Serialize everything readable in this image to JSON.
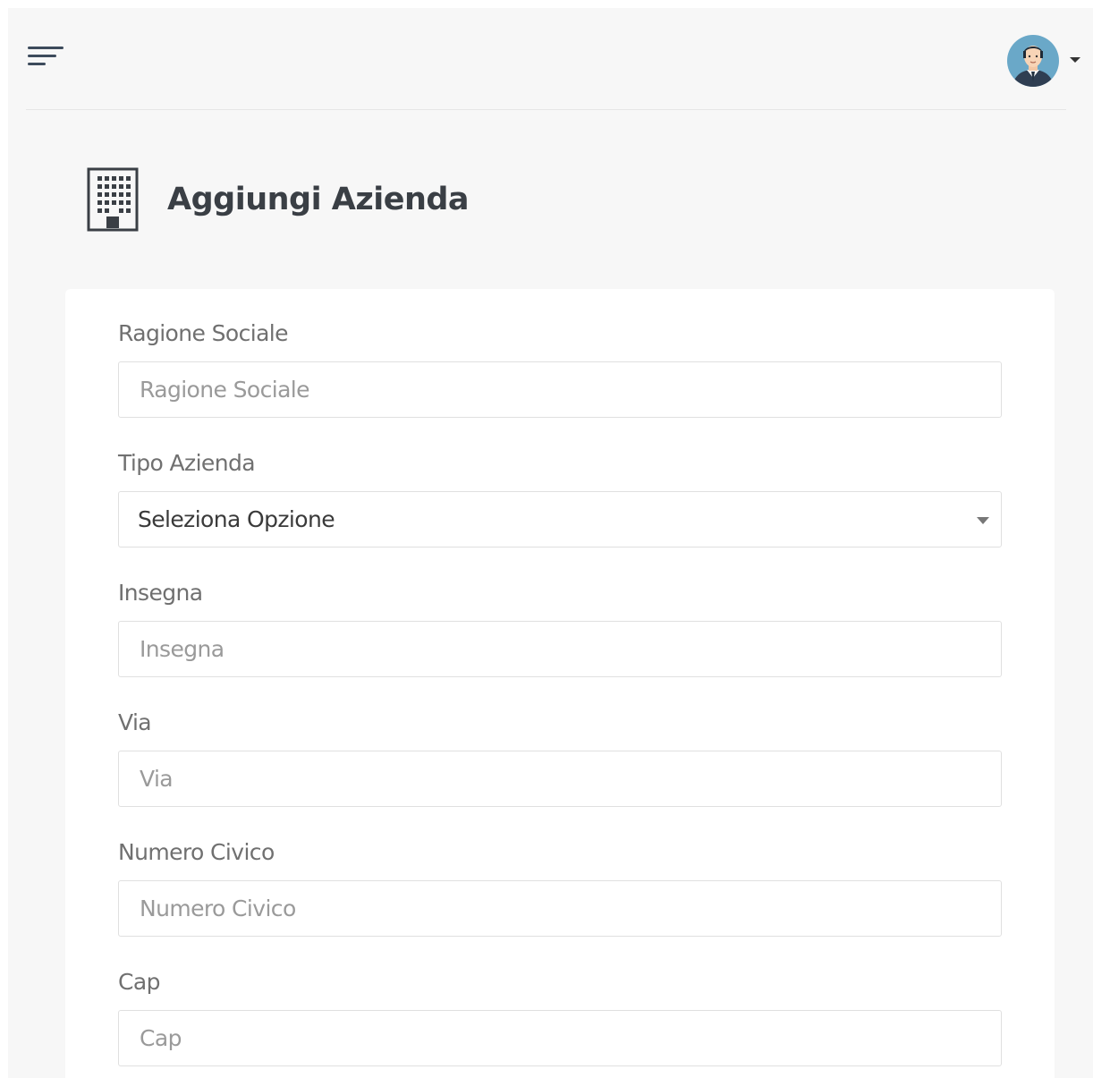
{
  "topbar": {
    "menu_icon": "hamburger-menu-icon",
    "avatar_icon": "user-avatar",
    "dropdown_icon": "caret-down-icon"
  },
  "header": {
    "icon": "building-icon",
    "title": "Aggiungi Azienda"
  },
  "form": {
    "ragione_sociale": {
      "label": "Ragione Sociale",
      "placeholder": "Ragione Sociale",
      "value": ""
    },
    "tipo_azienda": {
      "label": "Tipo Azienda",
      "selected": "Seleziona Opzione"
    },
    "insegna": {
      "label": "Insegna",
      "placeholder": "Insegna",
      "value": ""
    },
    "via": {
      "label": "Via",
      "placeholder": "Via",
      "value": ""
    },
    "numero_civico": {
      "label": "Numero Civico",
      "placeholder": "Numero Civico",
      "value": ""
    },
    "cap": {
      "label": "Cap",
      "placeholder": "Cap",
      "value": ""
    }
  },
  "colors": {
    "background": "#f7f7f7",
    "card": "#ffffff",
    "title": "#3a3f45",
    "label": "#707070",
    "placeholder": "#9a9a9a",
    "border": "#e0e0e0"
  }
}
